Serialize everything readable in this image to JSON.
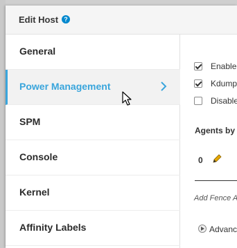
{
  "dialog": {
    "title": "Edit Host",
    "help_icon": "question-circle-icon"
  },
  "sidebar": {
    "items": [
      {
        "label": "General",
        "active": false
      },
      {
        "label": "Power Management",
        "active": true
      },
      {
        "label": "SPM",
        "active": false
      },
      {
        "label": "Console",
        "active": false
      },
      {
        "label": "Kernel",
        "active": false
      },
      {
        "label": "Affinity Labels",
        "active": false
      }
    ]
  },
  "power_management": {
    "options": [
      {
        "label": "Enable",
        "checked": true
      },
      {
        "label": "Kdump",
        "checked": true
      },
      {
        "label": "Disable",
        "checked": false
      }
    ],
    "agents_heading": "Agents by",
    "agent_count": "0",
    "add_fence_label": "Add Fence A",
    "advanced_label": "Advanc"
  },
  "colors": {
    "accent": "#39a5dc",
    "help": "#0088ce",
    "pencil": "#e6a800"
  }
}
